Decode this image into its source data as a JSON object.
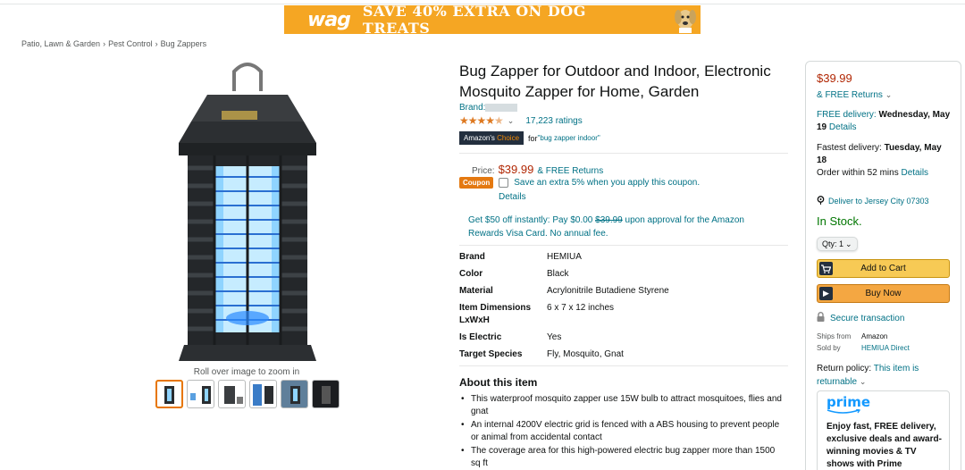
{
  "banner": {
    "brand": "wag",
    "message": "SAVE 40% EXTRA ON DOG TREATS",
    "accent": "#f5a623"
  },
  "breadcrumb": [
    "Patio, Lawn & Garden",
    "›",
    "Pest Control",
    "›",
    "Bug Zappers"
  ],
  "gallery": {
    "zoom_hint": "Roll over image to zoom in",
    "thumbnail_count": 6
  },
  "product": {
    "title": "Bug Zapper for Outdoor and Indoor, Electronic Mosquito Zapper for Home, Garden",
    "brand_label": "Brand:",
    "rating_stars": 4.5,
    "rating_chevron": "⌄",
    "ratings_count": "17,223 ratings",
    "choice_label_a": "Amazon's ",
    "choice_label_b": "Choice",
    "choice_for": "for ",
    "choice_query": "\"bug zapper indoor\"",
    "price_label": "Price:",
    "price": "$39.99",
    "returns": "& FREE Returns",
    "coupon_badge": "Coupon",
    "coupon_text": "Save an extra 5% when you apply this coupon.",
    "coupon_details": "Details",
    "rewards_a": "Get $50 off instantly: Pay $0.00 ",
    "rewards_strike": "$39.99",
    "rewards_b": " upon approval for the Amazon Rewards Visa Card. No annual fee."
  },
  "specs": [
    {
      "key": "Brand",
      "value": "HEMIUA"
    },
    {
      "key": "Color",
      "value": "Black"
    },
    {
      "key": "Material",
      "value": "Acrylonitrile Butadiene Styrene"
    },
    {
      "key": "Item Dimensions LxWxH",
      "value": "6 x 7 x 12 inches"
    },
    {
      "key": "Is Electric",
      "value": "Yes"
    },
    {
      "key": "Target Species",
      "value": "Fly, Mosquito, Gnat"
    }
  ],
  "about": {
    "title": "About this item",
    "items": [
      "This waterproof mosquito zapper use 15W bulb to attract mosquitoes, flies and gnat",
      "An internal 4200V electric grid is fenced with a ABS housing to prevent people or animal from accidental contact",
      "The coverage area for this high-powered electric bug zapper more than 1500 sq ft"
    ]
  },
  "buybox": {
    "price": "$39.99",
    "returns": "& FREE Returns",
    "returns_chevron": "⌄",
    "delivery_a": "FREE delivery: ",
    "delivery_date": "Wednesday, May 19",
    "delivery_details": "Details",
    "fast_a": "Fastest delivery: ",
    "fast_date": "Tuesday, May 18",
    "fast_order": "Order within 52 mins ",
    "fast_details": "Details",
    "deliver_to": "Deliver to Jersey City 07303",
    "stock": "In Stock.",
    "qty_label": "Qty: 1",
    "qty_chevron": "⌄",
    "add_to_cart": "Add to Cart",
    "buy_now": "Buy Now",
    "secure": "Secure transaction",
    "ships_from_label": "Ships from",
    "ships_from": "Amazon",
    "sold_by_label": "Sold by",
    "sold_by": "HEMIUA Direct",
    "return_policy_label": "Return policy: ",
    "return_policy": "This item is returnable",
    "return_chevron": "⌄",
    "prime_logo": "prime",
    "prime_text": "Enjoy fast, FREE delivery, exclusive deals and award-winning movies & TV shows with Prime"
  },
  "colors": {
    "price": "#b12704",
    "link": "#007185",
    "stock": "#007600",
    "star": "#de7921",
    "cart_button": "#f7ca55",
    "buy_button": "#f4a742"
  }
}
